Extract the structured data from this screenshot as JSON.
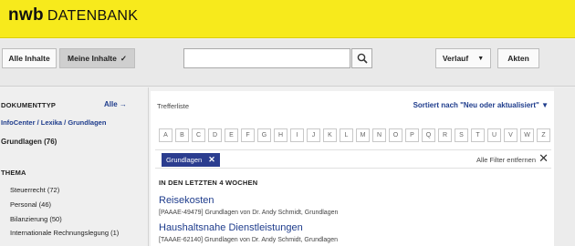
{
  "header": {
    "brand_bold": "nwb",
    "brand_rest": "DATENBANK"
  },
  "toolbar": {
    "alle_inhalte": "Alle Inhalte",
    "meine_inhalte": "Meine Inhalte",
    "meine_check": "✓",
    "search_value": "",
    "search_placeholder": "",
    "verlauf": "Verlauf",
    "verlauf_caret": "▼",
    "akten": "Akten"
  },
  "sidebar": {
    "doctype_title": "DOKUMENTTYP",
    "alle_link": "Alle →",
    "path_link": "InfoCenter / Lexika / Grundlagen",
    "selected_count": "Grundlagen (76)",
    "thema_title": "THEMA",
    "thema_items": [
      "Steuerrecht (72)",
      "Personal (46)",
      "Bilanzierung (50)",
      "Internationale Rechnungslegung (1)"
    ]
  },
  "main": {
    "trefferliste": "Trefferliste",
    "sort_label": "Sortiert nach \"Neu oder aktualisiert\" ▼",
    "alphabet": [
      "A",
      "B",
      "C",
      "D",
      "E",
      "F",
      "G",
      "H",
      "I",
      "J",
      "K",
      "L",
      "M",
      "N",
      "O",
      "P",
      "Q",
      "R",
      "S",
      "T",
      "U",
      "V",
      "W",
      "Z"
    ],
    "filter_chip": "Grundlagen",
    "chip_close": "✕",
    "remove_all": "Alle Filter entfernen",
    "remove_all_icon": "✕",
    "section_title": "IN DEN LETZTEN 4 WOCHEN",
    "results": [
      {
        "title": "Reisekosten",
        "meta": "[PAAAE-49479] Grundlagen von Dr. Andy Schmidt, Grundlagen"
      },
      {
        "title": "Haushaltsnahe Dienstleistungen",
        "meta": "[TAAAE-62140] Grundlagen von Dr. Andy Schmidt, Grundlagen"
      }
    ]
  }
}
